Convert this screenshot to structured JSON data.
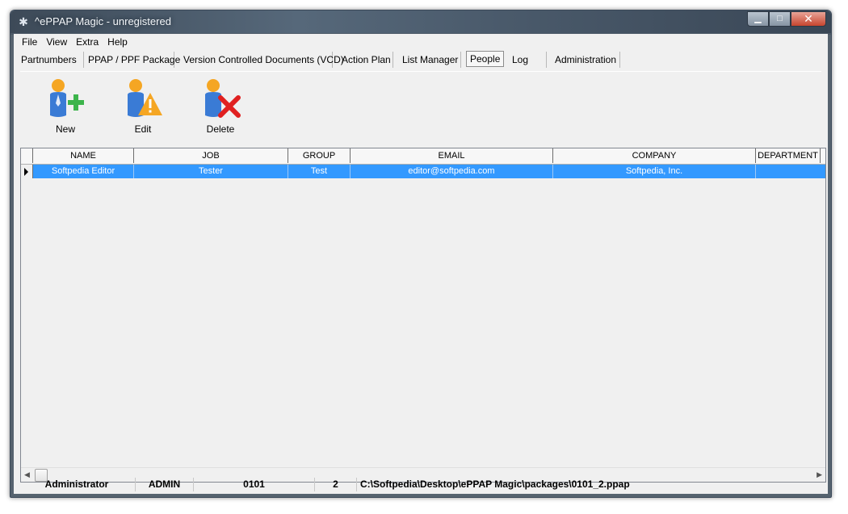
{
  "window": {
    "title": "^ePPAP Magic - unregistered",
    "app_icon": "gear-icon"
  },
  "menu": [
    "File",
    "View",
    "Extra",
    "Help"
  ],
  "tabs": [
    "Partnumbers",
    "PPAP / PPF Package",
    "Version Controlled Documents (VCD)",
    "Action Plan",
    "List Manager",
    "People",
    "Log",
    "Administration"
  ],
  "active_tab": "People",
  "toolbar": {
    "new_label": "New",
    "edit_label": "Edit",
    "delete_label": "Delete"
  },
  "grid": {
    "columns": [
      "NAME",
      "JOB",
      "GROUP",
      "EMAIL",
      "COMPANY",
      "DEPARTMENT"
    ],
    "rows": [
      {
        "name": "Softpedia Editor",
        "job": "Tester",
        "group": "Test",
        "email": "editor@softpedia.com",
        "company": "Softpedia, Inc.",
        "department": ""
      }
    ]
  },
  "status": {
    "user": "Administrator",
    "role": "ADMIN",
    "partnumber": "0101",
    "count": "2",
    "path": "C:\\Softpedia\\Desktop\\ePPAP Magic\\packages\\0101_2.ppap"
  },
  "colors": {
    "selection": "#3399ff",
    "accent_person": "#f5a623",
    "accent_blue": "#3a7bd5",
    "add_green": "#3cb44b",
    "delete_red": "#e02020"
  }
}
